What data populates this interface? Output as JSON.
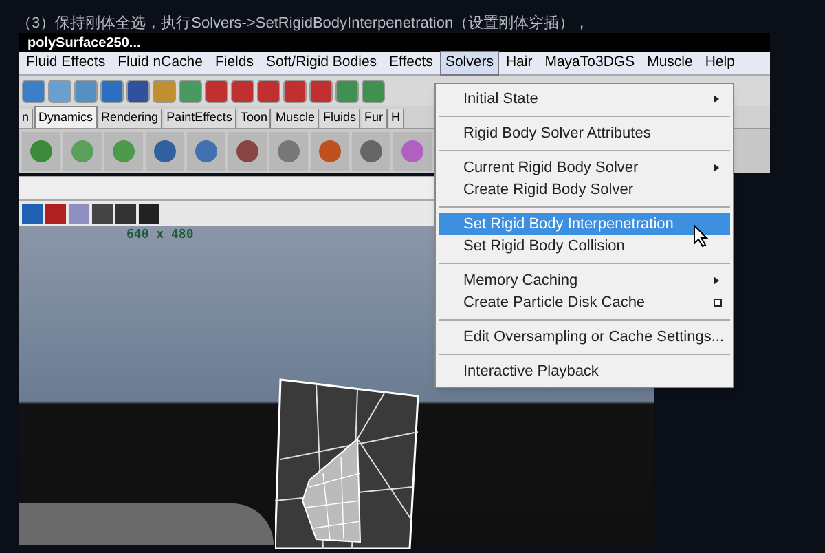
{
  "caption": "（3）保持刚体全选，执行Solvers->SetRigidBodyInterpenetration（设置刚体穿插），",
  "window": {
    "title": "polySurface250..."
  },
  "menu_bar": [
    {
      "label": "Fluid Effects",
      "selected": false
    },
    {
      "label": "Fluid nCache",
      "selected": false
    },
    {
      "label": "Fields",
      "selected": false
    },
    {
      "label": "Soft/Rigid Bodies",
      "selected": false
    },
    {
      "label": "Effects",
      "selected": false
    },
    {
      "label": "Solvers",
      "selected": true
    },
    {
      "label": "Hair",
      "selected": false
    },
    {
      "label": "MayaTo3DGS",
      "selected": false
    },
    {
      "label": "Muscle",
      "selected": false
    },
    {
      "label": "Help",
      "selected": false
    }
  ],
  "shelf_tabs": [
    {
      "label": "n",
      "selected": false
    },
    {
      "label": "Dynamics",
      "selected": true
    },
    {
      "label": "Rendering",
      "selected": false
    },
    {
      "label": "PaintEffects",
      "selected": false
    },
    {
      "label": "Toon",
      "selected": false
    },
    {
      "label": "Muscle",
      "selected": false
    },
    {
      "label": "Fluids",
      "selected": false
    },
    {
      "label": "Fur",
      "selected": false
    },
    {
      "label": "H",
      "selected": false
    }
  ],
  "viewport": {
    "resolution": "640 x 480"
  },
  "dropdown": [
    {
      "kind": "item",
      "label": "Initial State",
      "submenu": true,
      "option_box": false,
      "selected": false
    },
    {
      "kind": "separator"
    },
    {
      "kind": "item",
      "label": "Rigid Body Solver Attributes",
      "submenu": false,
      "option_box": false,
      "selected": false
    },
    {
      "kind": "separator"
    },
    {
      "kind": "item",
      "label": "Current Rigid Body Solver",
      "submenu": true,
      "option_box": false,
      "selected": false
    },
    {
      "kind": "item",
      "label": "Create Rigid Body Solver",
      "submenu": false,
      "option_box": false,
      "selected": false
    },
    {
      "kind": "separator"
    },
    {
      "kind": "item",
      "label": "Set Rigid Body Interpenetration",
      "submenu": false,
      "option_box": false,
      "selected": true
    },
    {
      "kind": "item",
      "label": "Set Rigid Body Collision",
      "submenu": false,
      "option_box": false,
      "selected": false
    },
    {
      "kind": "separator"
    },
    {
      "kind": "item",
      "label": "Memory Caching",
      "submenu": true,
      "option_box": false,
      "selected": false
    },
    {
      "kind": "item",
      "label": "Create Particle Disk Cache",
      "submenu": false,
      "option_box": true,
      "selected": false
    },
    {
      "kind": "separator"
    },
    {
      "kind": "item",
      "label": "Edit Oversampling or Cache Settings...",
      "submenu": false,
      "option_box": false,
      "selected": false
    },
    {
      "kind": "separator"
    },
    {
      "kind": "item",
      "label": "Interactive Playback",
      "submenu": false,
      "option_box": false,
      "selected": false
    }
  ]
}
